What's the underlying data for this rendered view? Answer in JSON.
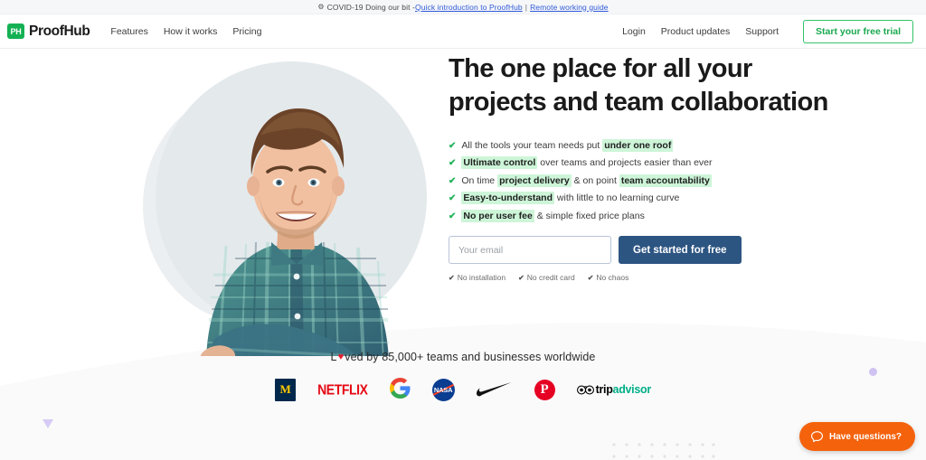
{
  "banner": {
    "icon": "virus-icon",
    "text": "COVID-19 Doing our bit - ",
    "link1": "Quick introduction to ProofHub",
    "separator": " | ",
    "link2": "Remote working guide"
  },
  "header": {
    "logo_mark": "PH",
    "logo_text": "ProofHub",
    "nav_left": [
      {
        "label": "Features"
      },
      {
        "label": "How it works"
      },
      {
        "label": "Pricing"
      }
    ],
    "nav_right": [
      {
        "label": "Login"
      },
      {
        "label": "Product updates"
      },
      {
        "label": "Support"
      }
    ],
    "trial_button": "Start your free trial"
  },
  "hero": {
    "headline": "The one place for all your projects and team collaboration",
    "bullets": [
      {
        "pre": "All the tools your team needs put ",
        "hl": "under one roof",
        "post": ""
      },
      {
        "pre": "",
        "hl": "Ultimate control",
        "post": " over teams and projects easier than ever"
      },
      {
        "pre": "On time ",
        "hl": "project delivery",
        "mid": " & on point ",
        "hl2": "team accountability",
        "post": ""
      },
      {
        "pre": "",
        "hl": "Easy-to-understand",
        "post": " with little to no learning curve"
      },
      {
        "pre": "",
        "hl": "No per user fee",
        "post": " & simple fixed price plans"
      }
    ],
    "email_placeholder": "Your email",
    "email_value": "",
    "cta_button": "Get started for free",
    "micro_items": [
      {
        "label": "No installation"
      },
      {
        "label": "No credit card"
      },
      {
        "label": "No chaos"
      }
    ],
    "image_alt": "smiling man in teal plaid shirt with arms crossed"
  },
  "proof": {
    "loved_prefix": "L",
    "loved_heart": "♥",
    "loved_suffix": "ved by 85,000+ teams and businesses worldwide",
    "logos": [
      {
        "name": "michigan",
        "label": "M"
      },
      {
        "name": "netflix",
        "label": "NETFLIX"
      },
      {
        "name": "google",
        "label": "G"
      },
      {
        "name": "nasa",
        "label": "NASA"
      },
      {
        "name": "nike",
        "label": "swoosh"
      },
      {
        "name": "pinterest",
        "label": "P"
      },
      {
        "name": "tripadvisor",
        "label_dark": "trip",
        "label_green": "advisor"
      }
    ]
  },
  "chat": {
    "label": "Have questions?",
    "icon": "chat-bubble-icon"
  },
  "colors": {
    "brand_green": "#13b153",
    "cta_navy": "#2d5582",
    "highlight_green": "#cdf5d8",
    "link_blue": "#2f5bd8",
    "chat_orange": "#f4620c",
    "accent_purple": "#cfc2f2",
    "heart_red": "#e8192c"
  }
}
